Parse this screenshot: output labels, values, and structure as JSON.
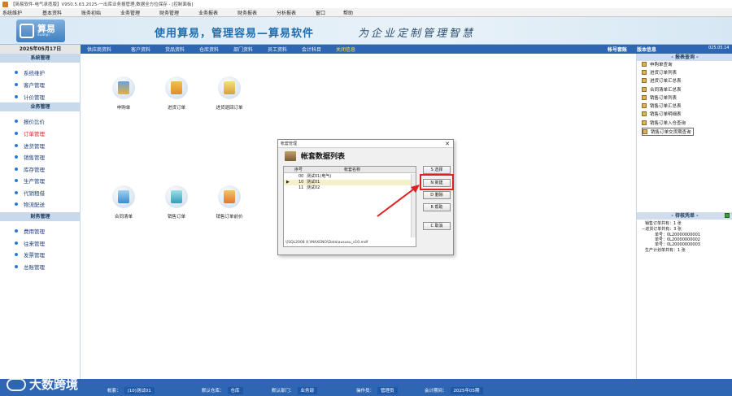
{
  "window": {
    "title": "【简易软件-电气承揽版】V950.5.63.2025-一出库业务报管理,数据全方位保存 - [控制面板]"
  },
  "menubar": {
    "items": [
      "系统维护",
      "基本资料",
      "账务初始",
      "业务管理",
      "财务管理",
      "业务报表",
      "财务报表",
      "分析报表",
      "窗口",
      "帮助"
    ]
  },
  "banner": {
    "logo_text": "算易",
    "logo_sub": "suanyi",
    "slogan": "使用算易，管理容易—算易软件",
    "slogan_right": "为企业定制管理智慧"
  },
  "datebar": {
    "date": "2025年05月17日"
  },
  "navbar": {
    "links": [
      "供应商资料",
      "客户资料",
      "货品资料",
      "仓库资料",
      "部门资料",
      "员工资料",
      "会计科目",
      "关闭信息"
    ],
    "right_links": [
      "帐号套账",
      "版本信息"
    ],
    "right_date": "025.05.14"
  },
  "sidebar": {
    "sections": [
      {
        "title": "系统管理",
        "items": [
          "系统维护",
          "客户管理",
          "计价管理"
        ]
      },
      {
        "title": "业务管理",
        "items": [
          "报价比价",
          "订单管理",
          "进货管理",
          "销售管理",
          "库存管理",
          "生产管理",
          "代销租借",
          "物流配送"
        ]
      },
      {
        "title": "财务管理",
        "items": [
          "费用管理",
          "往来管理",
          "发票管理",
          "总账管理"
        ]
      }
    ]
  },
  "modules": [
    {
      "label": "申购单",
      "icon": "books-icon"
    },
    {
      "label": "进货订单",
      "icon": "note-icon"
    },
    {
      "label": "进货退回订单",
      "icon": "note-return-icon"
    },
    {
      "label": "合同清单",
      "icon": "pen-icon"
    },
    {
      "label": "销售订单",
      "icon": "truck-icon"
    },
    {
      "label": "销售订单前价",
      "icon": "warm-icon"
    }
  ],
  "dialog": {
    "window_title": "帐套管理",
    "header": "帐套数据列表",
    "columns": [
      "序号",
      "帐套名称"
    ],
    "rows": [
      {
        "pointer": "",
        "no": "00",
        "name": "测试01(电气)"
      },
      {
        "pointer": "▶",
        "no": "10",
        "name": "测试01"
      },
      {
        "pointer": "",
        "no": "11",
        "name": "测试02"
      }
    ],
    "db_path": "\\[SQL2008 X:\\MAXENO\\Data\\aususu_s10.mdf",
    "buttons": [
      "S 选择",
      "N 新建",
      "D 删除",
      "R 帮助",
      "C 取消"
    ]
  },
  "rpanel": {
    "report_header": "- 报表查询 -",
    "reports": [
      "申购单查询",
      "进货订单列表",
      "进货订单汇总表",
      "合同清单汇总表",
      "销售订单列表",
      "销售订单汇总表",
      "销售订单明细表",
      "销售订单入仓查询",
      "销售订单交货期查询"
    ],
    "todo_header": "- 待核凭单 -",
    "todo_lines": [
      "销售订单共有：1 张",
      "−进货订单共有：3 张",
      "单号：0L20000000001",
      "单号：0L20000000002",
      "单号：0L20000000003",
      "生产计划单共有：1 张"
    ]
  },
  "statusbar": {
    "fields": [
      {
        "label": "帐套：",
        "value": "(10)测试01"
      },
      {
        "label": "默认仓库：",
        "value": "仓库"
      },
      {
        "label": "默认部门：",
        "value": "业务部"
      },
      {
        "label": "操作员：",
        "value": "管理员"
      },
      {
        "label": "会计期间：",
        "value": "2025年05期"
      }
    ],
    "watermark": "大数跨境"
  }
}
